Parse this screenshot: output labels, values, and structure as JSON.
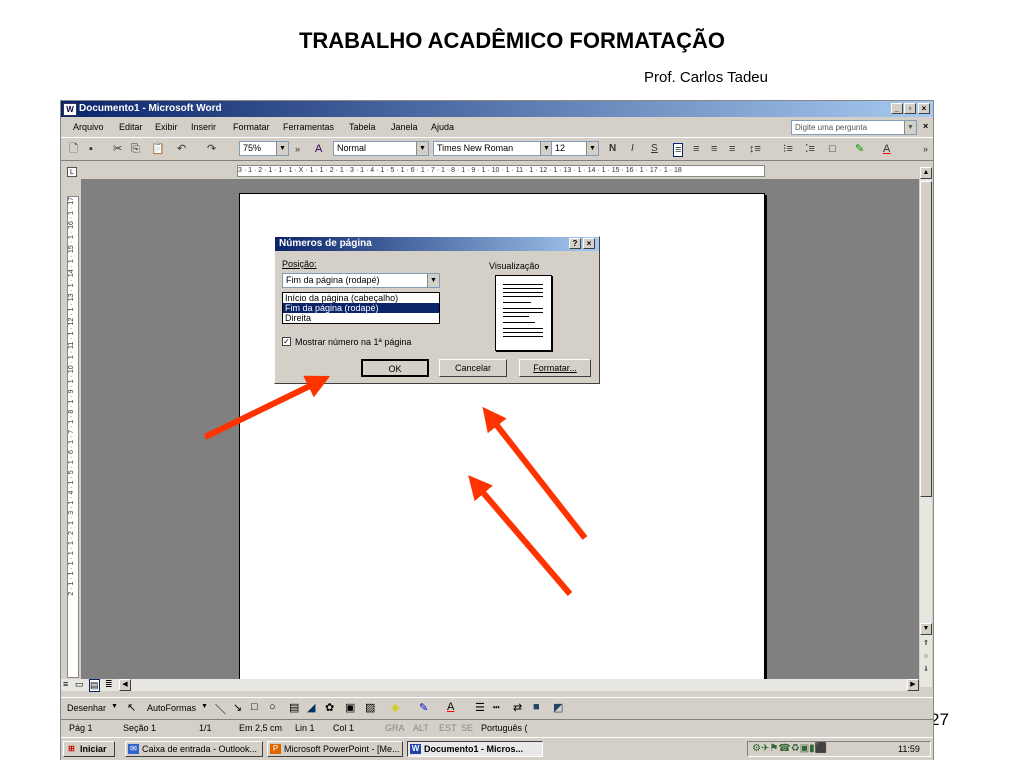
{
  "slide": {
    "title": "TRABALHO ACADÊMICO FORMATAÇÃO",
    "subtitle": "Prof. Carlos Tadeu",
    "page_number": "27"
  },
  "window": {
    "title": "Documento1 - Microsoft Word",
    "ask_placeholder": "Digite uma pergunta"
  },
  "menu": [
    "Arquivo",
    "Editar",
    "Exibir",
    "Inserir",
    "Formatar",
    "Ferramentas",
    "Tabela",
    "Janela",
    "Ajuda"
  ],
  "toolbar": {
    "zoom": "75%",
    "style": "Normal",
    "font": "Times New Roman",
    "size": "12",
    "bold": "N",
    "italic": "I",
    "underline": "S"
  },
  "ruler": {
    "horizontal": "3 · 1 · 2 · 1 · 1 · 1 · X · 1 · 1 · 2 · 1 · 3 · 1 · 4 · 1 · 5 · 1 · 6 · 1 · 7 · 1 · 8 · 1 · 9 · 1 · 10 · 1 · 11 · 1 · 12 · 1 · 13 · 1 · 14 · 1 · 15 · 16 · 1 · 17 · 1 · 18",
    "vertical": "2 · 1 · 1 · 1 · 1 · 1 · 2 · 1 · 3 · 1 · 4 · 1 · 5 · 1 · 6 · 1 · 7 · 1 · 8 · 1 · 9 · 1 · 10 · 1 · 11 · 1 · 12 · 1 · 13 · 1 · 14 · 1 · 15 · 1 · 16 · 1 · 17"
  },
  "drawing_toolbar": {
    "draw": "Desenhar",
    "autoshapes": "AutoFormas"
  },
  "status": {
    "page": "Pág 1",
    "section": "Seção 1",
    "pages": "1/1",
    "at": "Em 2,5 cm",
    "line": "Lin 1",
    "col": "Col 1",
    "rec": "GRA",
    "trk": "ALT",
    "ext": "EST",
    "ovr": "SE",
    "lang": "Português ("
  },
  "taskbar": {
    "start": "Iniciar",
    "tasks": [
      "Caixa de entrada - Outlook...",
      "Microsoft PowerPoint - [Me...",
      "Documento1 - Micros..."
    ],
    "clock": "11:59"
  },
  "dialog": {
    "title": "Números de página",
    "position_label": "Posição:",
    "position_value": "Fim da página (rodapé)",
    "options": [
      "Início da página (cabeçalho)",
      "Fim da página (rodapé)",
      "Direita"
    ],
    "preview_label": "Visualização",
    "show_first_page": "Mostrar número na 1ª página",
    "ok": "OK",
    "cancel": "Cancelar",
    "format": "Formatar..."
  },
  "colors": {
    "title_bar": "#0a246a",
    "arrow": "#ff3300",
    "document_bg": "#808080"
  }
}
